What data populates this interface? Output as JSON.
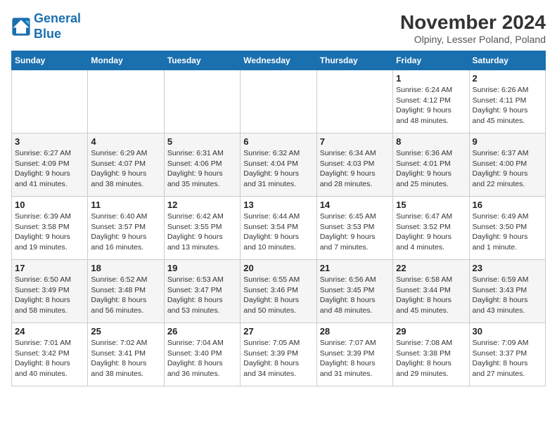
{
  "logo": {
    "line1": "General",
    "line2": "Blue"
  },
  "title": "November 2024",
  "location": "Olpiny, Lesser Poland, Poland",
  "weekdays": [
    "Sunday",
    "Monday",
    "Tuesday",
    "Wednesday",
    "Thursday",
    "Friday",
    "Saturday"
  ],
  "weeks": [
    [
      {
        "day": "",
        "info": ""
      },
      {
        "day": "",
        "info": ""
      },
      {
        "day": "",
        "info": ""
      },
      {
        "day": "",
        "info": ""
      },
      {
        "day": "",
        "info": ""
      },
      {
        "day": "1",
        "info": "Sunrise: 6:24 AM\nSunset: 4:12 PM\nDaylight: 9 hours\nand 48 minutes."
      },
      {
        "day": "2",
        "info": "Sunrise: 6:26 AM\nSunset: 4:11 PM\nDaylight: 9 hours\nand 45 minutes."
      }
    ],
    [
      {
        "day": "3",
        "info": "Sunrise: 6:27 AM\nSunset: 4:09 PM\nDaylight: 9 hours\nand 41 minutes."
      },
      {
        "day": "4",
        "info": "Sunrise: 6:29 AM\nSunset: 4:07 PM\nDaylight: 9 hours\nand 38 minutes."
      },
      {
        "day": "5",
        "info": "Sunrise: 6:31 AM\nSunset: 4:06 PM\nDaylight: 9 hours\nand 35 minutes."
      },
      {
        "day": "6",
        "info": "Sunrise: 6:32 AM\nSunset: 4:04 PM\nDaylight: 9 hours\nand 31 minutes."
      },
      {
        "day": "7",
        "info": "Sunrise: 6:34 AM\nSunset: 4:03 PM\nDaylight: 9 hours\nand 28 minutes."
      },
      {
        "day": "8",
        "info": "Sunrise: 6:36 AM\nSunset: 4:01 PM\nDaylight: 9 hours\nand 25 minutes."
      },
      {
        "day": "9",
        "info": "Sunrise: 6:37 AM\nSunset: 4:00 PM\nDaylight: 9 hours\nand 22 minutes."
      }
    ],
    [
      {
        "day": "10",
        "info": "Sunrise: 6:39 AM\nSunset: 3:58 PM\nDaylight: 9 hours\nand 19 minutes."
      },
      {
        "day": "11",
        "info": "Sunrise: 6:40 AM\nSunset: 3:57 PM\nDaylight: 9 hours\nand 16 minutes."
      },
      {
        "day": "12",
        "info": "Sunrise: 6:42 AM\nSunset: 3:55 PM\nDaylight: 9 hours\nand 13 minutes."
      },
      {
        "day": "13",
        "info": "Sunrise: 6:44 AM\nSunset: 3:54 PM\nDaylight: 9 hours\nand 10 minutes."
      },
      {
        "day": "14",
        "info": "Sunrise: 6:45 AM\nSunset: 3:53 PM\nDaylight: 9 hours\nand 7 minutes."
      },
      {
        "day": "15",
        "info": "Sunrise: 6:47 AM\nSunset: 3:52 PM\nDaylight: 9 hours\nand 4 minutes."
      },
      {
        "day": "16",
        "info": "Sunrise: 6:49 AM\nSunset: 3:50 PM\nDaylight: 9 hours\nand 1 minute."
      }
    ],
    [
      {
        "day": "17",
        "info": "Sunrise: 6:50 AM\nSunset: 3:49 PM\nDaylight: 8 hours\nand 58 minutes."
      },
      {
        "day": "18",
        "info": "Sunrise: 6:52 AM\nSunset: 3:48 PM\nDaylight: 8 hours\nand 56 minutes."
      },
      {
        "day": "19",
        "info": "Sunrise: 6:53 AM\nSunset: 3:47 PM\nDaylight: 8 hours\nand 53 minutes."
      },
      {
        "day": "20",
        "info": "Sunrise: 6:55 AM\nSunset: 3:46 PM\nDaylight: 8 hours\nand 50 minutes."
      },
      {
        "day": "21",
        "info": "Sunrise: 6:56 AM\nSunset: 3:45 PM\nDaylight: 8 hours\nand 48 minutes."
      },
      {
        "day": "22",
        "info": "Sunrise: 6:58 AM\nSunset: 3:44 PM\nDaylight: 8 hours\nand 45 minutes."
      },
      {
        "day": "23",
        "info": "Sunrise: 6:59 AM\nSunset: 3:43 PM\nDaylight: 8 hours\nand 43 minutes."
      }
    ],
    [
      {
        "day": "24",
        "info": "Sunrise: 7:01 AM\nSunset: 3:42 PM\nDaylight: 8 hours\nand 40 minutes."
      },
      {
        "day": "25",
        "info": "Sunrise: 7:02 AM\nSunset: 3:41 PM\nDaylight: 8 hours\nand 38 minutes."
      },
      {
        "day": "26",
        "info": "Sunrise: 7:04 AM\nSunset: 3:40 PM\nDaylight: 8 hours\nand 36 minutes."
      },
      {
        "day": "27",
        "info": "Sunrise: 7:05 AM\nSunset: 3:39 PM\nDaylight: 8 hours\nand 34 minutes."
      },
      {
        "day": "28",
        "info": "Sunrise: 7:07 AM\nSunset: 3:39 PM\nDaylight: 8 hours\nand 31 minutes."
      },
      {
        "day": "29",
        "info": "Sunrise: 7:08 AM\nSunset: 3:38 PM\nDaylight: 8 hours\nand 29 minutes."
      },
      {
        "day": "30",
        "info": "Sunrise: 7:09 AM\nSunset: 3:37 PM\nDaylight: 8 hours\nand 27 minutes."
      }
    ]
  ]
}
